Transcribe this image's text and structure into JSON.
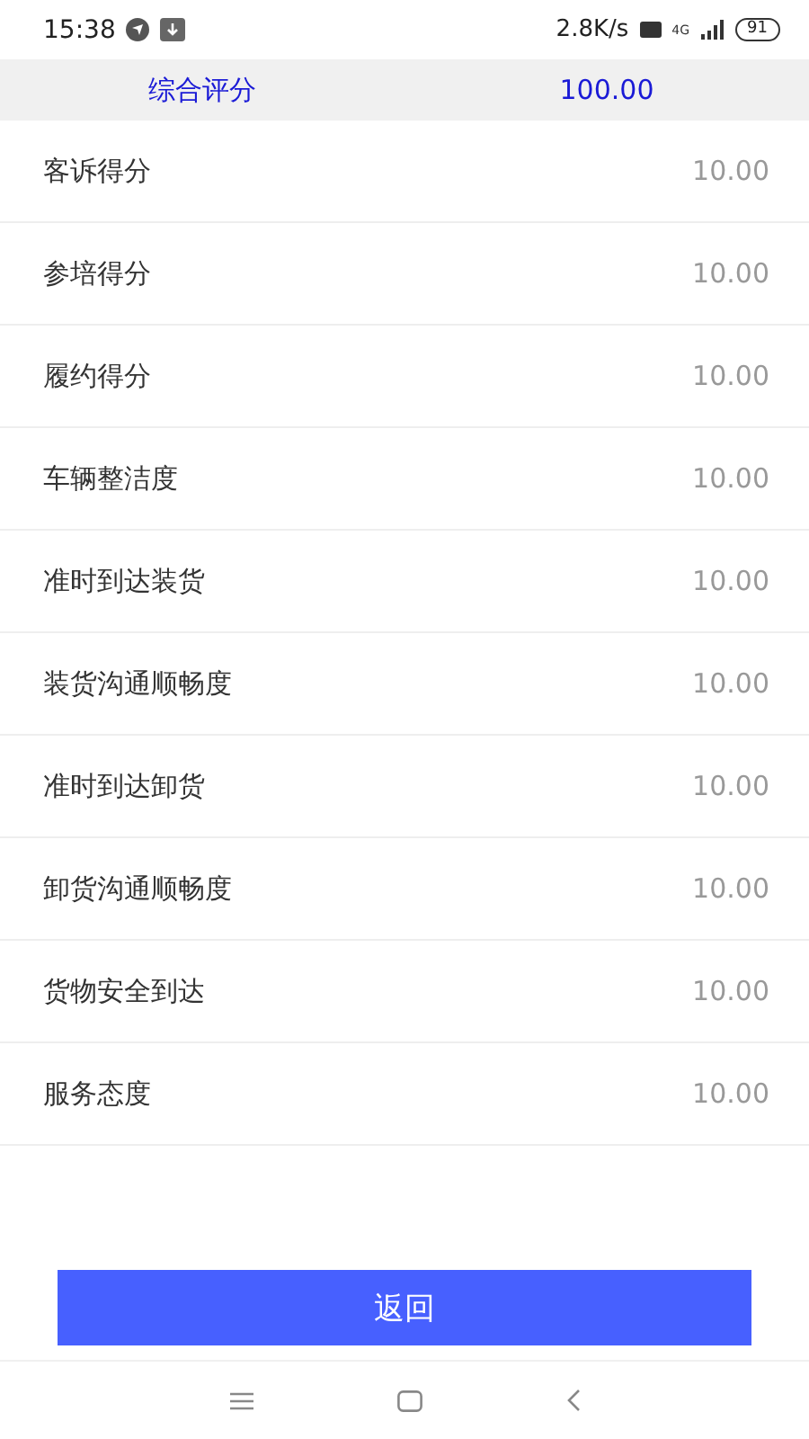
{
  "status_bar": {
    "time": "15:38",
    "speed": "2.8K/s",
    "network": "4G",
    "battery": "91"
  },
  "summary": {
    "label": "综合评分",
    "value": "100.00"
  },
  "scores": [
    {
      "label": "客诉得分",
      "value": "10.00"
    },
    {
      "label": "参培得分",
      "value": "10.00"
    },
    {
      "label": "履约得分",
      "value": "10.00"
    },
    {
      "label": "车辆整洁度",
      "value": "10.00"
    },
    {
      "label": "准时到达装货",
      "value": "10.00"
    },
    {
      "label": "装货沟通顺畅度",
      "value": "10.00"
    },
    {
      "label": "准时到达卸货",
      "value": "10.00"
    },
    {
      "label": "卸货沟通顺畅度",
      "value": "10.00"
    },
    {
      "label": "货物安全到达",
      "value": "10.00"
    },
    {
      "label": "服务态度",
      "value": "10.00"
    }
  ],
  "back_button": "返回"
}
